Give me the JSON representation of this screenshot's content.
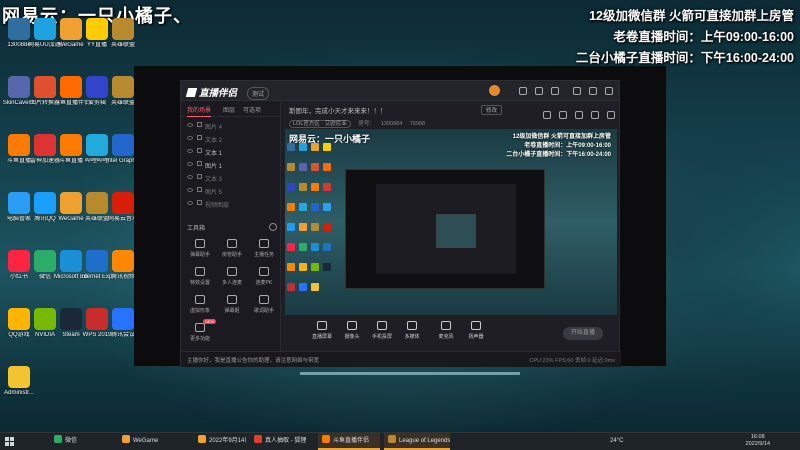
{
  "overlay": {
    "title": "网易云：一只小橘子、",
    "right_line1": "12级加微信群 火箭可直接加群上房管",
    "right_line2": "老卷直播时间：上午09:00-16:00",
    "right_line3": "二台小橘子直播时间：下午16:00-24:00"
  },
  "desktop_icons": [
    {
      "label": "1300884",
      "color": "#2f6f9f"
    },
    {
      "label": "网易UU加速器",
      "color": "#1fa3e0"
    },
    {
      "label": "WeGame",
      "color": "#f0a030"
    },
    {
      "label": "YY直播",
      "color": "#ffcc00"
    },
    {
      "label": "英雄联盟",
      "color": "#b88a2e"
    },
    {
      "label": "SkinCaver...",
      "color": "#5566aa"
    },
    {
      "label": "图片转换器",
      "color": "#e05030"
    },
    {
      "label": "斗鱼直播伴侣",
      "color": "#ff6a00"
    },
    {
      "label": "爱剪辑",
      "color": "#3344cc"
    },
    {
      "label": "英雄联盟",
      "color": "#b88a2e"
    },
    {
      "label": "斗鱼直播",
      "color": "#ff7a00"
    },
    {
      "label": "雷神加速器",
      "color": "#dd3333"
    },
    {
      "label": "斗鱼直播",
      "color": "#ff7a00"
    },
    {
      "label": "哔哩哔哩",
      "color": "#22aadd"
    },
    {
      "label": "Intel Graphics",
      "color": "#2266cc"
    },
    {
      "label": "电脑管家",
      "color": "#2a9df4"
    },
    {
      "label": "腾讯QQ",
      "color": "#1a9fff"
    },
    {
      "label": "WeGame",
      "color": "#f0a030"
    },
    {
      "label": "英雄联盟",
      "color": "#b88a2e"
    },
    {
      "label": "网易云音乐",
      "color": "#d81e06"
    },
    {
      "label": "小红书",
      "color": "#ff2442"
    },
    {
      "label": "微信",
      "color": "#2aae67"
    },
    {
      "label": "Microsoft Edge",
      "color": "#1a8fd6"
    },
    {
      "label": "Internet Explorer",
      "color": "#1e6fc9"
    },
    {
      "label": "腾讯视频",
      "color": "#ff8800"
    },
    {
      "label": "QQ游戏",
      "color": "#ffb400"
    },
    {
      "label": "NVIDIA",
      "color": "#76b900"
    },
    {
      "label": "Steam",
      "color": "#1b2838"
    },
    {
      "label": "WPS 2019",
      "color": "#c92c2c"
    },
    {
      "label": "腾讯会议",
      "color": "#2673ff"
    },
    {
      "label": "Administr...",
      "color": "#f4c430"
    }
  ],
  "app": {
    "logo": "直播伴侣",
    "version": "测试",
    "tabs": [
      "我的场景",
      "图层",
      "可选项"
    ],
    "scenes": [
      {
        "name": "图片 4",
        "on": false
      },
      {
        "name": "文本 2",
        "on": false
      },
      {
        "name": "文本 1",
        "on": true
      },
      {
        "name": "图片 1",
        "on": true
      },
      {
        "name": "文本 3",
        "on": false
      },
      {
        "name": "图片 5",
        "on": false
      },
      {
        "name": "视频图层",
        "on": false
      }
    ],
    "tools_title": "工具箱",
    "tools": [
      {
        "label": "弹幕助手",
        "badge": ""
      },
      {
        "label": "房管助手",
        "badge": ""
      },
      {
        "label": "主播任务",
        "badge": ""
      },
      {
        "label": "特效设置",
        "badge": ""
      },
      {
        "label": "多人连麦",
        "badge": ""
      },
      {
        "label": "连麦PK",
        "badge": ""
      },
      {
        "label": "虚拟形象",
        "badge": ""
      },
      {
        "label": "弹幕姬",
        "badge": ""
      },
      {
        "label": "歌词助手",
        "badge": ""
      },
      {
        "label": "更多功能",
        "badge": "NEW"
      }
    ],
    "announce": "斯图年，完成小天才来来来！！！",
    "announce_btn": "修改",
    "info_chip": "LOL官方区 · 艾欧尼亚",
    "info_id_label": "房号：",
    "info_id": "1300884",
    "info_fans": "76988",
    "bottom_tools": [
      "直播屏幕",
      "摄像头",
      "手机投屏",
      "多媒体",
      "麦克风",
      "扬声器"
    ],
    "live_btn": "开始直播",
    "status_msg": "主播你好，我是直播公告你的助理，请注意网络与带宽",
    "status_stats": "CPU:23%  FPS:60  丢帧:0  延迟:0ms"
  },
  "preview_overlay": {
    "title": "网易云：一只小橘子",
    "l1": "12级加微信群 火箭可直接加群上房管",
    "l2": "老卷直播时间：上午09:00-16:00",
    "l3": "二台小橘子直播时间：下午16:00-24:00"
  },
  "taskbar": {
    "items": [
      {
        "label": "微信",
        "color": "#2aae67",
        "active": false
      },
      {
        "label": "WeGame",
        "color": "#f0a030",
        "active": false
      },
      {
        "label": "2022年9月14日 不...",
        "color": "#f0a030",
        "active": false
      },
      {
        "label": "真人抽取 - 狐狸",
        "color": "#e0402a",
        "active": false
      },
      {
        "label": "斗鱼直播伴侣",
        "color": "#ff7a00",
        "active": true
      },
      {
        "label": "League of Legends",
        "color": "#b88a2e",
        "active": true
      }
    ],
    "temp": "24°C",
    "time": "16:08",
    "date": "2022/9/14"
  }
}
